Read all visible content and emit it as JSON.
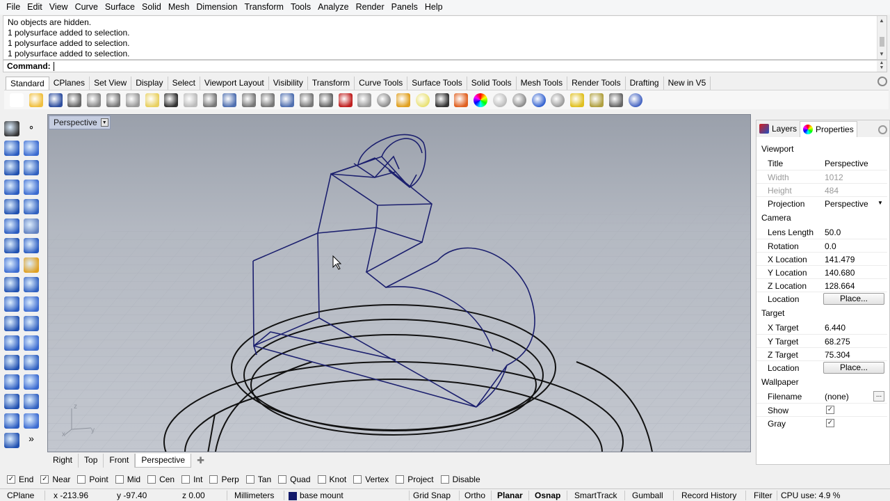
{
  "menu": [
    "File",
    "Edit",
    "View",
    "Curve",
    "Surface",
    "Solid",
    "Mesh",
    "Dimension",
    "Transform",
    "Tools",
    "Analyze",
    "Render",
    "Panels",
    "Help"
  ],
  "history": [
    "No objects are hidden.",
    "1 polysurface added to selection.",
    "1 polysurface added to selection.",
    "1 polysurface added to selection."
  ],
  "command_label": "Command:",
  "toolbar_tabs": [
    "Standard",
    "CPlanes",
    "Set View",
    "Display",
    "Select",
    "Viewport Layout",
    "Visibility",
    "Transform",
    "Curve Tools",
    "Surface Tools",
    "Solid Tools",
    "Mesh Tools",
    "Render Tools",
    "Drafting",
    "New in V5"
  ],
  "toolbar_icons": [
    "new-file-icon",
    "open-file-icon",
    "save-icon",
    "print-icon",
    "import-icon",
    "cut-icon",
    "copy-icon",
    "paste-icon",
    "undo-icon",
    "pan-hand-icon",
    "rotate-view-icon",
    "zoom-icon",
    "zoom-window-icon",
    "zoom-extents-icon",
    "zoom-selected-icon",
    "undo-view-icon",
    "four-viewports-icon",
    "car-icon",
    "gear-view-icon",
    "point-icon",
    "lights-icon",
    "bulb-icon",
    "lock-icon",
    "layer-icon",
    "color-wheel-icon",
    "wireframe-sphere-icon",
    "shaded-sphere-icon",
    "rendered-sphere-icon",
    "material-sphere-icon",
    "filter-icon",
    "options-gear-icon",
    "grid-icon",
    "help-icon"
  ],
  "viewport_title": "Perspective",
  "viewport_tabs": [
    "Right",
    "Top",
    "Front",
    "Perspective"
  ],
  "panel_tabs": {
    "layers": "Layers",
    "properties": "Properties"
  },
  "properties": {
    "section_viewport": "Viewport",
    "title_label": "Title",
    "title_value": "Perspective",
    "width_label": "Width",
    "width_value": "1012",
    "height_label": "Height",
    "height_value": "484",
    "projection_label": "Projection",
    "projection_value": "Perspective",
    "section_camera": "Camera",
    "lens_label": "Lens Length",
    "lens_value": "50.0",
    "rotation_label": "Rotation",
    "rotation_value": "0.0",
    "xloc_label": "X Location",
    "xloc_value": "141.479",
    "yloc_label": "Y Location",
    "yloc_value": "140.680",
    "zloc_label": "Z Location",
    "zloc_value": "128.664",
    "location_label": "Location",
    "place_label": "Place...",
    "section_target": "Target",
    "xt_label": "X Target",
    "xt_value": "6.440",
    "yt_label": "Y Target",
    "yt_value": "68.275",
    "zt_label": "Z Target",
    "zt_value": "75.304",
    "tlocation_label": "Location",
    "tplace_label": "Place...",
    "section_wallpaper": "Wallpaper",
    "filename_label": "Filename",
    "filename_value": "(none)",
    "show_label": "Show",
    "gray_label": "Gray",
    "ellipsis": "..."
  },
  "osnaps": [
    {
      "label": "End",
      "checked": true
    },
    {
      "label": "Near",
      "checked": true
    },
    {
      "label": "Point",
      "checked": false
    },
    {
      "label": "Mid",
      "checked": false
    },
    {
      "label": "Cen",
      "checked": false
    },
    {
      "label": "Int",
      "checked": false
    },
    {
      "label": "Perp",
      "checked": false
    },
    {
      "label": "Tan",
      "checked": false
    },
    {
      "label": "Quad",
      "checked": false
    },
    {
      "label": "Knot",
      "checked": false
    },
    {
      "label": "Vertex",
      "checked": false
    },
    {
      "label": "Project",
      "checked": false
    },
    {
      "label": "Disable",
      "checked": false
    }
  ],
  "status": {
    "cplane": "CPlane",
    "x": "x -213.96",
    "y": "y -97.40",
    "z": "z 0.00",
    "units": "Millimeters",
    "layer": "base mount",
    "layer_color": "#131a6a",
    "grid_snap": "Grid Snap",
    "ortho": "Ortho",
    "planar": "Planar",
    "osnap": "Osnap",
    "smarttrack": "SmartTrack",
    "gumball": "Gumball",
    "record_history": "Record History",
    "filter": "Filter",
    "cpu": "CPU use: 4.9 %"
  },
  "axis_labels": {
    "z": "z",
    "y": "y",
    "x": "x"
  },
  "colors": {
    "wire_selected": "#1b1f6e",
    "wire_black": "#111111",
    "viewport_bg": "#b4b9c2"
  }
}
